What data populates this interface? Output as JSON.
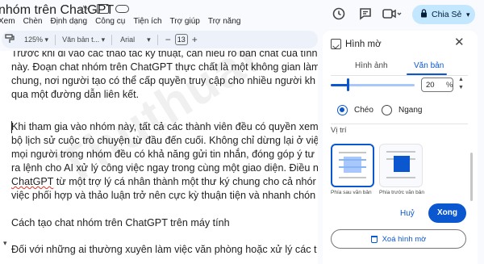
{
  "header": {
    "title": "nhóm trên ChatGPT",
    "menu": [
      "Xem",
      "Chèn",
      "Định dạng",
      "Công cụ",
      "Tiện ích",
      "Trợ giúp",
      "Trợ năng"
    ],
    "share_label": "Chia Sẻ"
  },
  "toolbar": {
    "zoom": "125%",
    "style": "Văn bản t...",
    "font": "Arial",
    "font_size": "13"
  },
  "document": {
    "paragraphs": [
      "Trước khi đi vào các thao tác kỹ thuật, cần hiểu rõ bản chất của tính",
      "này. Đoạn chat nhóm trên ChatGPT thực chất là một không gian làm",
      "chung, nơi người tạo có thể cấp quyền truy cập cho nhiều người kh",
      "qua một đường dẫn liên kết.",
      "Khi tham gia vào nhóm này, tất cả các thành viên đều có quyền xem",
      "bộ lịch sử cuộc trò chuyện từ đầu đến cuối. Không chỉ dừng lại ở việ",
      "mọi người trong nhóm đều có khả năng gửi tin nhắn, đóng góp ý tư",
      "ra lệnh cho AI xử lý công việc ngay trong cùng một giao diện. Điều n",
      "việc phối hợp và thảo luận trở nên cực kỳ thuận tiện và nhanh chón",
      "Cách tạo chat nhóm trên ChatGPT trên máy tính",
      "Đối với những ai thường xuyên làm việc văn phòng hoặc xử lý các t"
    ],
    "red_word": "ChatGPT",
    "line8_rest": " từ một trợ lý cá nhân thành một thư ký chung cho cả nhór"
  },
  "watermark_panel": {
    "title": "Hình mờ",
    "tabs": [
      "Hình ảnh",
      "Văn bản"
    ],
    "active_tab": 1,
    "transparency_value": "20",
    "transparency_unit": "%",
    "transparency_fraction": 0.2,
    "orientation_options": [
      "Chéo",
      "Ngang"
    ],
    "orientation_selected": 0,
    "position_label": "Vị trí",
    "position_options": [
      "Phía sau văn bản",
      "Phía trước văn bản"
    ],
    "position_selected": 0,
    "cancel_label": "Huỷ",
    "ok_label": "Xong",
    "remove_label": "Xoá hình mờ"
  },
  "colors": {
    "accent": "#0b57d0",
    "share_bg": "#c2e7ff",
    "spell_error": "#d93025"
  }
}
